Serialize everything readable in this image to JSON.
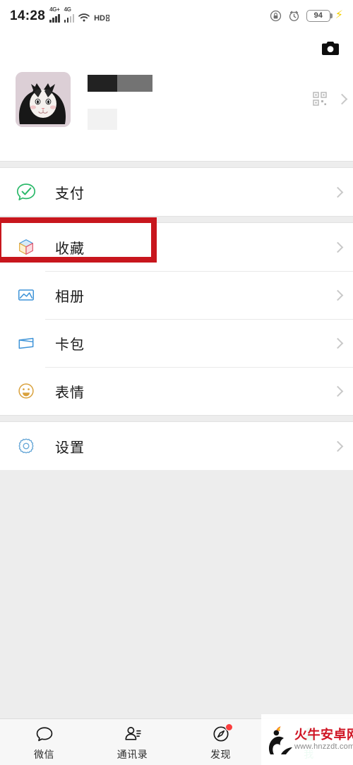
{
  "statusbar": {
    "time": "14:28",
    "network_label_1": "4G+",
    "network_label_2": "4G",
    "hd_label": "HD",
    "battery_percent": "94",
    "icons": {
      "signal": "signal-bars-icon",
      "wifi": "wifi-icon",
      "hd": "hd-volte-icon",
      "lock": "screen-lock-icon",
      "alarm": "alarm-clock-icon",
      "battery": "battery-icon",
      "charging": "charging-bolt-icon"
    }
  },
  "profile": {
    "camera_icon": "camera-icon",
    "avatar_alt": "cat-avatar",
    "nickname_redacted": "",
    "wechat_id_redacted": "",
    "qr_icon": "qr-code-icon",
    "chevron_icon": "chevron-right-icon"
  },
  "menu": {
    "groups": [
      {
        "items": [
          {
            "label": "支付",
            "icon": "payment-icon"
          }
        ]
      },
      {
        "items": [
          {
            "label": "收藏",
            "icon": "favorites-cube-icon",
            "highlighted": true
          },
          {
            "label": "相册",
            "icon": "album-photo-icon"
          },
          {
            "label": "卡包",
            "icon": "card-wallet-icon"
          },
          {
            "label": "表情",
            "icon": "sticker-smiley-icon"
          }
        ]
      },
      {
        "items": [
          {
            "label": "设置",
            "icon": "settings-gear-icon"
          }
        ]
      }
    ]
  },
  "annotation": {
    "color": "#c8161d",
    "target_label": "收藏"
  },
  "tabbar": {
    "tabs": [
      {
        "label": "微信",
        "icon": "chat-bubble-icon",
        "active": false,
        "badge": false
      },
      {
        "label": "通讯录",
        "icon": "contacts-icon",
        "active": false,
        "badge": false
      },
      {
        "label": "发现",
        "icon": "compass-discover-icon",
        "active": false,
        "badge": true
      },
      {
        "label": "我",
        "icon": "profile-person-icon",
        "active": true,
        "badge": false
      }
    ]
  },
  "watermark": {
    "title": "火牛安卓网",
    "url": "www.hnzzdt.com"
  }
}
